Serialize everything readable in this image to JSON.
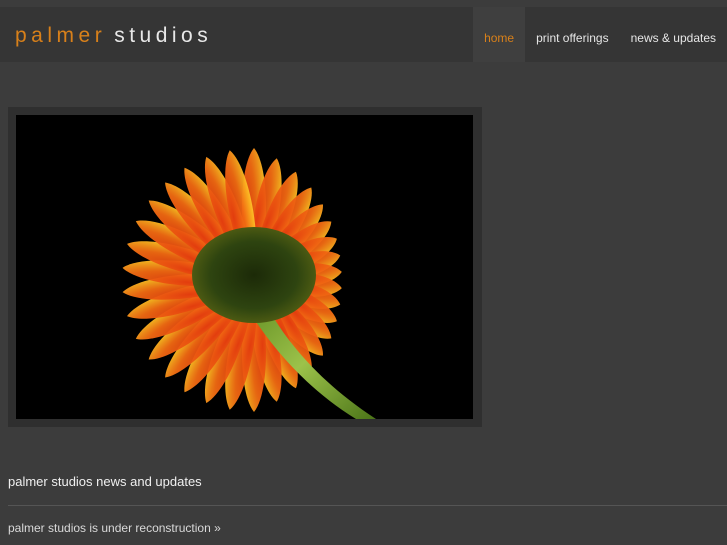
{
  "header": {
    "logo_first": "palmer",
    "logo_second": "studios",
    "nav": [
      {
        "label": "home",
        "active": true
      },
      {
        "label": "print offerings",
        "active": false
      },
      {
        "label": "news & updates",
        "active": false
      }
    ]
  },
  "colors": {
    "accent": "#d8801a",
    "background": "#3c3c3c",
    "header": "#353535"
  },
  "gallery": {
    "image_subject": "orange-gerbera-daisy-photo"
  },
  "news": {
    "heading": "palmer studios news and updates",
    "link": "palmer studios is under reconstruction »"
  }
}
